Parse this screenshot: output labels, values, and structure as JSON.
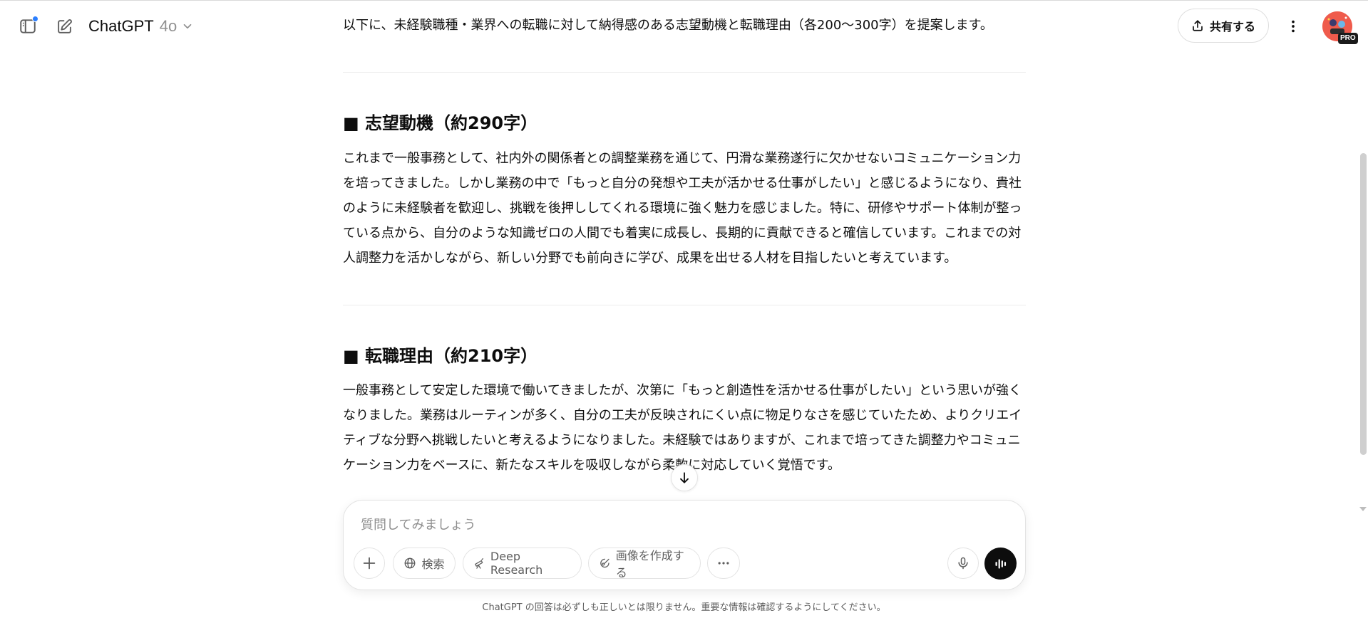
{
  "header": {
    "model_name": "ChatGPT",
    "model_version": "4o",
    "share_label": "共有する",
    "avatar_badge": "PRO"
  },
  "conversation": {
    "intro": "以下に、未経験職種・業界への転職に対して納得感のある志望動機と転職理由（各200〜300字）を提案します。",
    "sections": [
      {
        "title": "■ 志望動機（約290字）",
        "body": "これまで一般事務として、社内外の関係者との調整業務を通じて、円滑な業務遂行に欠かせないコミュニケーション力を培ってきました。しかし業務の中で「もっと自分の発想や工夫が活かせる仕事がしたい」と感じるようになり、貴社のように未経験者を歓迎し、挑戦を後押ししてくれる環境に強く魅力を感じました。特に、研修やサポート体制が整っている点から、自分のような知識ゼロの人間でも着実に成長し、長期的に貢献できると確信しています。これまでの対人調整力を活かしながら、新しい分野でも前向きに学び、成果を出せる人材を目指したいと考えています。"
      },
      {
        "title": "■ 転職理由（約210字）",
        "body": "一般事務として安定した環境で働いてきましたが、次第に「もっと創造性を活かせる仕事がしたい」という思いが強くなりました。業務はルーティンが多く、自分の工夫が反映されにくい点に物足りなさを感じていたため、よりクリエイティブな分野へ挑戦したいと考えるようになりました。未経験ではありますが、これまで培ってきた調整力やコミュニケーション力をベースに、新たなスキルを吸収しながら柔軟に対応していく覚悟です。"
      }
    ]
  },
  "composer": {
    "placeholder": "質問してみましょう",
    "value": "",
    "tools": {
      "search": "検索",
      "deep_research": "Deep Research",
      "create_image": "画像を作成する"
    }
  },
  "footer": {
    "disclaimer": "ChatGPT の回答は必ずしも正しいとは限りません。重要な情報は確認するようにしてください。"
  },
  "colors": {
    "text": "#0d0d0d",
    "muted": "#8f8f8f",
    "border": "#e3e3e3",
    "notification": "#2b7fff",
    "voice_button": "#0d0d0d"
  }
}
